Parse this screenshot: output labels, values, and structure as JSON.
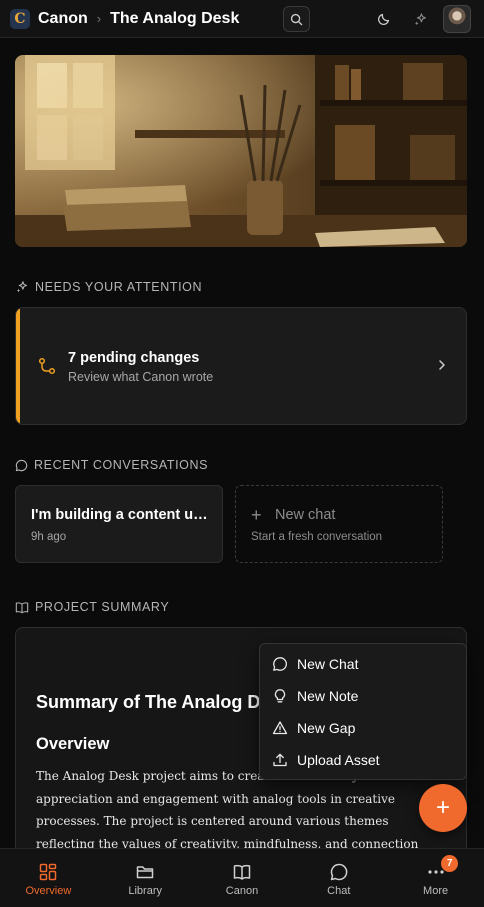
{
  "header": {
    "logo_letter": "C",
    "brand": "Canon",
    "breadcrumb_separator": "›",
    "project_title": "The Analog Desk"
  },
  "hero": {
    "icon": "hero-illustration-analog-desk"
  },
  "attention": {
    "heading": "NEEDS YOUR ATTENTION",
    "card": {
      "title": "7 pending changes",
      "subtitle": "Review what Canon wrote"
    }
  },
  "conversations": {
    "heading": "RECENT CONVERSATIONS",
    "items": [
      {
        "title": "I'm building a content un...",
        "time": "9h ago"
      }
    ],
    "new_chat": {
      "title": "New chat",
      "subtitle": "Start a fresh conversation"
    }
  },
  "summary": {
    "heading": "PROJECT SUMMARY",
    "title": "Summary of The Analog De",
    "overview_heading": "Overview",
    "body": "The Analog Desk project aims to create a community around appreciation and engagement with analog tools in creative processes. The project is centered around various themes reflecting the values of creativity, mindfulness, and connection to traditional art forms."
  },
  "menu": {
    "items": [
      {
        "label": "New Chat",
        "icon": "chat-bubble-icon"
      },
      {
        "label": "New Note",
        "icon": "lightbulb-icon"
      },
      {
        "label": "New Gap",
        "icon": "warning-triangle-icon"
      },
      {
        "label": "Upload Asset",
        "icon": "upload-icon"
      }
    ]
  },
  "fab": {
    "label": "+"
  },
  "nav": {
    "items": [
      {
        "label": "Overview",
        "icon": "grid-icon",
        "active": true
      },
      {
        "label": "Library",
        "icon": "folder-icon"
      },
      {
        "label": "Canon",
        "icon": "book-icon"
      },
      {
        "label": "Chat",
        "icon": "chat-icon"
      },
      {
        "label": "More",
        "icon": "more-dots-icon",
        "badge": "7"
      }
    ]
  },
  "colors": {
    "accent": "#f0692d",
    "warning": "#f0a020",
    "background": "#0b0b0b"
  }
}
